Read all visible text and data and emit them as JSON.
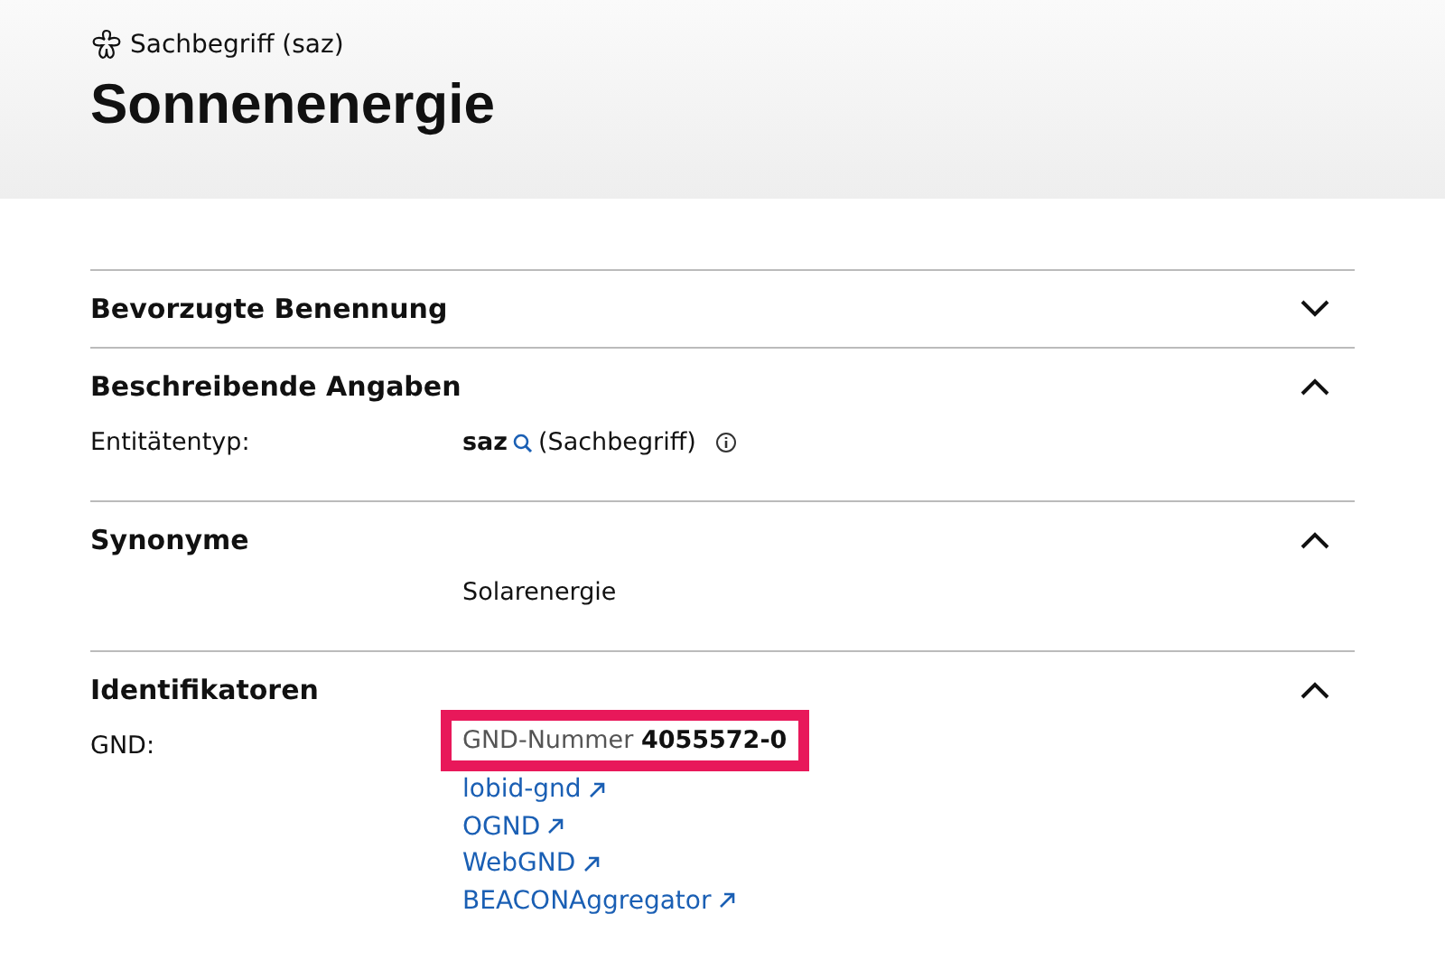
{
  "header": {
    "type_label": "Sachbegriff (saz)",
    "title": "Sonnenenergie"
  },
  "sections": [
    {
      "title": "Bevorzugte Benennung",
      "expanded": false
    },
    {
      "title": "Beschreibende Angaben",
      "expanded": true,
      "rows": [
        {
          "kind": "entity",
          "label": "Entitätentyp:",
          "code": "saz",
          "text": "(Sachbegriff)"
        }
      ]
    },
    {
      "title": "Synonyme",
      "expanded": true,
      "rows": [
        {
          "kind": "plain",
          "text": "Solarenergie"
        }
      ]
    },
    {
      "title": "Identifikatoren",
      "expanded": true,
      "rows": [
        {
          "kind": "ids",
          "label": "GND:",
          "number_label": "GND-Nummer",
          "number": "4055572-0",
          "links": [
            "lobid-gnd",
            "OGND",
            "WebGND",
            "BEACONAggregator"
          ]
        }
      ]
    }
  ]
}
